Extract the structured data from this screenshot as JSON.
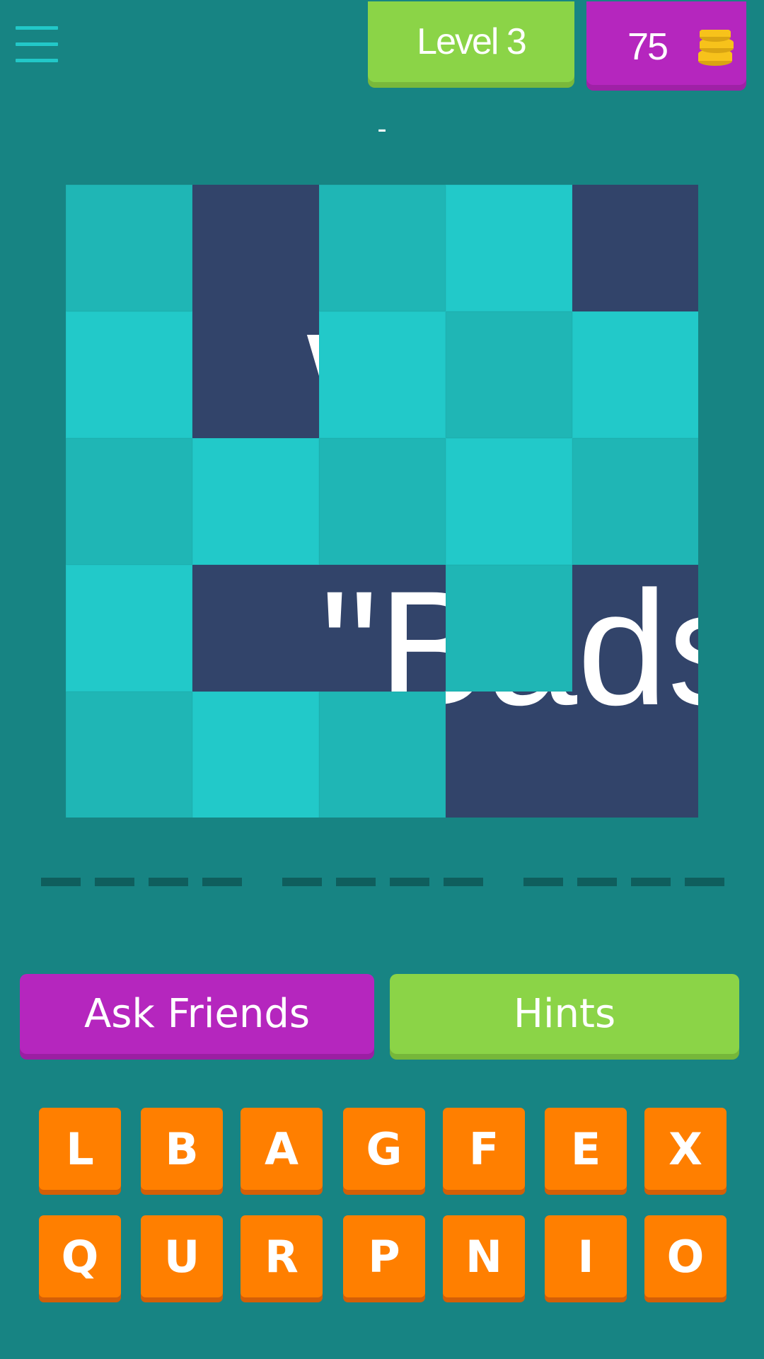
{
  "header": {
    "menu_icon": "hamburger-icon",
    "level_label": "Level 3",
    "coins": "75",
    "coins_icon": "coin-stack-icon"
  },
  "hint_text": "-",
  "puzzle": {
    "visible_text_fragments": [
      "\"Bads",
      "W"
    ]
  },
  "answer": {
    "words": [
      4,
      4,
      4
    ]
  },
  "actions": {
    "ask_friends_label": "Ask Friends",
    "hints_label": "Hints"
  },
  "letters": {
    "row1": [
      "L",
      "B",
      "A",
      "G",
      "F",
      "E",
      "X"
    ],
    "row2": [
      "Q",
      "U",
      "R",
      "P",
      "N",
      "I",
      "O"
    ]
  },
  "colors": {
    "background": "#178483",
    "tile_light": "#22c9c9",
    "tile_mid": "#1fb6b5",
    "image_bg": "#32446a",
    "level_green": "#8bd447",
    "purple": "#b526be",
    "key_orange": "#ff7f00",
    "coin_gold": "#f7c21b"
  }
}
